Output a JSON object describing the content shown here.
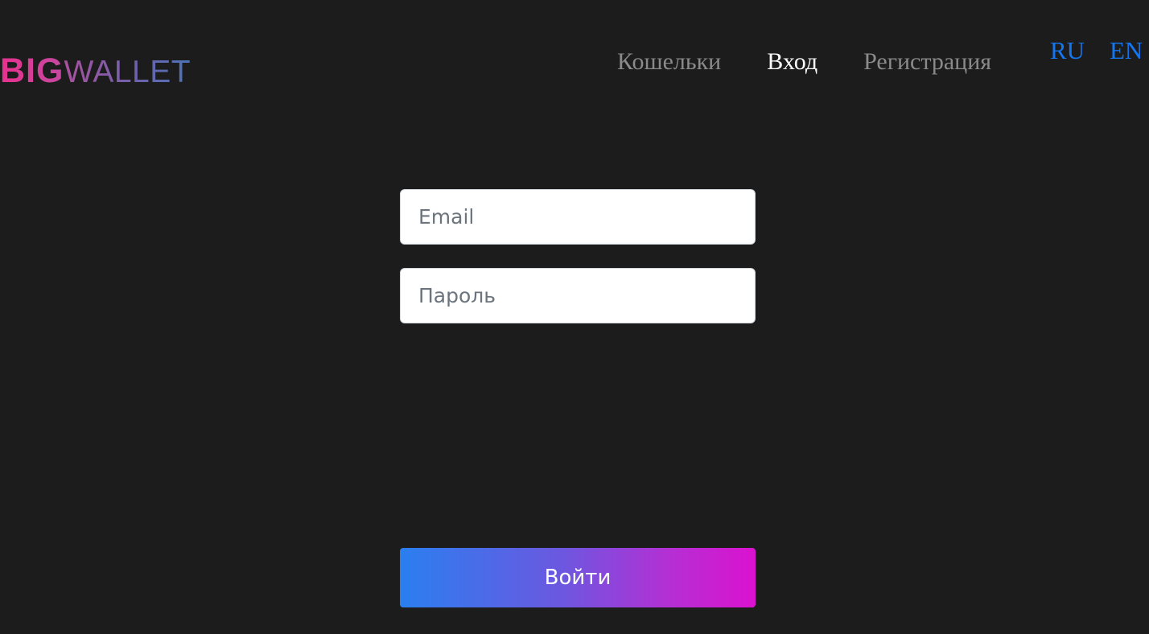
{
  "logo": {
    "part1": "BIG",
    "part2": "WALLET"
  },
  "nav": {
    "items": [
      {
        "label": "Кошельки",
        "active": false
      },
      {
        "label": "Вход",
        "active": true
      },
      {
        "label": "Регистрация",
        "active": false
      }
    ]
  },
  "language": {
    "ru": "RU",
    "en": "EN"
  },
  "form": {
    "email_placeholder": "Email",
    "email_value": "",
    "password_placeholder": "Пароль",
    "password_value": "",
    "submit_label": "Войти"
  },
  "colors": {
    "background": "#1c1c1c",
    "lang_link": "#1476f0",
    "nav_inactive": "#8a8a8a",
    "nav_active": "#ffffff",
    "logo_pink": "#e8318f",
    "logo_blue": "#4c73b8",
    "button_gradient_start": "#2a7ff0",
    "button_gradient_end": "#db12cf"
  }
}
